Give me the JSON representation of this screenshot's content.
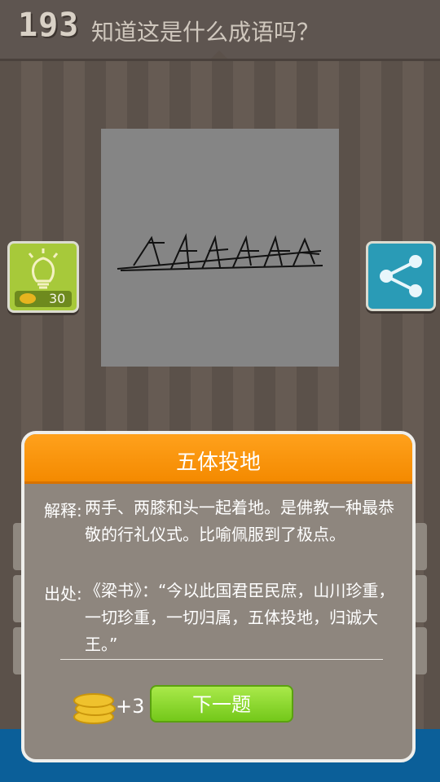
{
  "header": {
    "level": "193",
    "question": "知道这是什么成语吗？"
  },
  "hint": {
    "icon": "lightbulb-icon",
    "cost": "30"
  },
  "share": {
    "icon": "share-icon"
  },
  "dialog": {
    "title": "五体投地",
    "explanation_label": "解释:",
    "explanation_text": "两手、两膝和头一起着地。是佛教一种最恭敬的行礼仪式。比喻佩服到了极点。",
    "source_label": "出处:",
    "source_text": "《梁书》：“今以此国君臣民庶，山川珍重，一切珍重，一切归属，五体投地，归诚大王。”",
    "reward": "+3",
    "next_label": "下一题"
  },
  "colors": {
    "accent_orange": "#f48a00",
    "next_green": "#74c81a",
    "hint_green": "#a7c93a",
    "share_blue": "#2a9bb6"
  }
}
